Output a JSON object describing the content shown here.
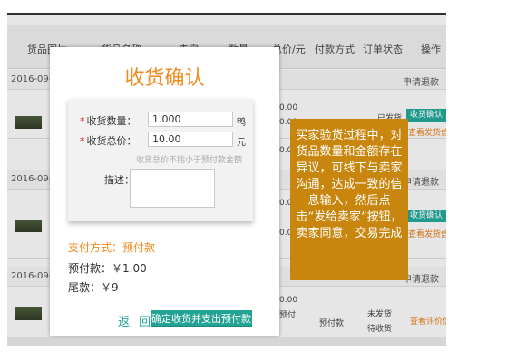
{
  "table_header": {
    "product_image": "货品图片",
    "product_name": "货品名称",
    "seller": "卖家",
    "quantity": "数量",
    "total_price": "总价/元",
    "payment_method": "付款方式",
    "order_status": "订单状态",
    "actions": "操作"
  },
  "orders": [
    {
      "date": "2016-09-",
      "right_link": "申请退款"
    },
    {
      "date": "2016-09-",
      "right_link": "申请退款"
    },
    {
      "date": "2016-09-",
      "right_link": "申请退款"
    }
  ],
  "background_row": {
    "price_fragment": "0.00",
    "payment": "预付款",
    "status_shipped": "已发货",
    "status_not_shipped": "未发货",
    "status_waiting": "待收货",
    "confirm_receipt": "收货确认",
    "view_ship_info": "查看发货信息",
    "view_review_info": "查看评价信息",
    "prepay_fragment": "预付:"
  },
  "modal": {
    "title": "收货确认",
    "quantity_label": "收货数量：",
    "quantity_value": "1.000",
    "quantity_unit": "鸭",
    "total_label": "收货总价：",
    "total_value": "10.00",
    "total_unit": "元",
    "hint": "收货总价不能小于预付款金额",
    "description_label": "描述：",
    "payment_type": "支付方式：预付款",
    "prepay": "预付款：￥1.00",
    "balance": "尾款：￥9",
    "back_button": "返 回",
    "confirm_button": "确定收货并支出预付款"
  },
  "callout": {
    "text": "买家验货过程中，对货品数量和金额存在异议，可线下与卖家沟通，达成一致的信息输入，然后点击“发给卖家”按钮，卖家同意，交易完成"
  },
  "colors": {
    "accent_orange": "#f08a1c",
    "teal": "#22a394",
    "callout_bg": "#c8860f",
    "required_star": "#d9302c"
  }
}
